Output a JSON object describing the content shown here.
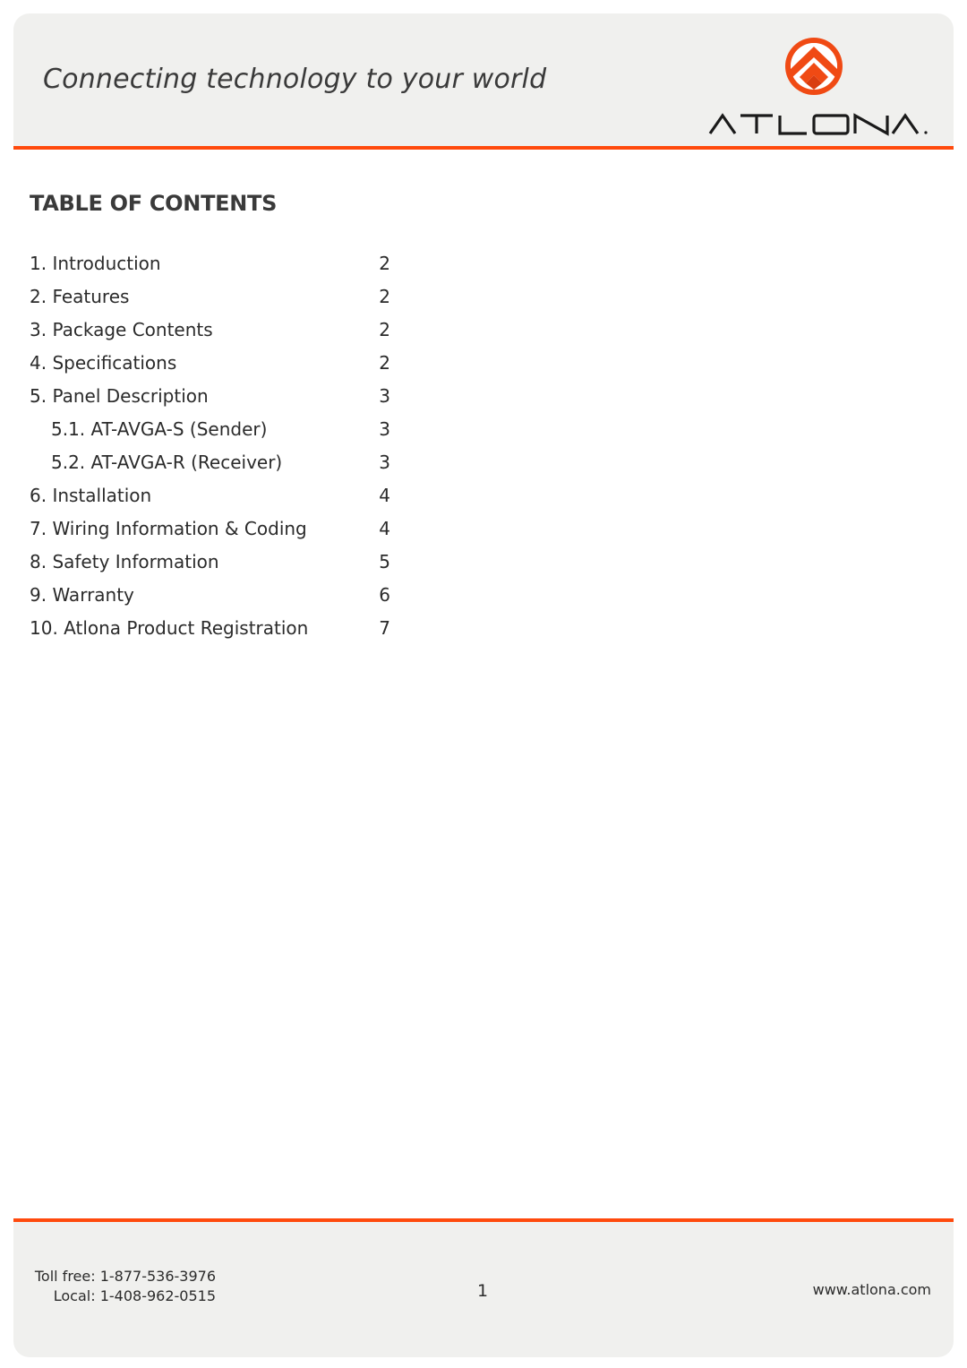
{
  "header": {
    "tagline": "Connecting technology to your world",
    "logo_text": "ATLONA",
    "accent_color": "#ff4a0d"
  },
  "toc": {
    "title": "TABLE OF CONTENTS",
    "entries": [
      {
        "label": "1. Introduction",
        "page": "2",
        "level": 1
      },
      {
        "label": "2. Features",
        "page": "2",
        "level": 1
      },
      {
        "label": "3. Package Contents",
        "page": "2",
        "level": 1
      },
      {
        "label": "4. Specifications",
        "page": "2",
        "level": 1
      },
      {
        "label": "5. Panel Description",
        "page": "3",
        "level": 1
      },
      {
        "label": "5.1. AT-AVGA-S (Sender)",
        "page": "3",
        "level": 2
      },
      {
        "label": "5.2. AT-AVGA-R (Receiver)",
        "page": "3",
        "level": 2
      },
      {
        "label": "6. Installation",
        "page": "4",
        "level": 1
      },
      {
        "label": "7. Wiring Information & Coding",
        "page": "4",
        "level": 1
      },
      {
        "label": "8. Safety Information",
        "page": "5",
        "level": 1
      },
      {
        "label": "9. Warranty",
        "page": "6",
        "level": 1
      },
      {
        "label": "10. Atlona Product Registration",
        "page": "7",
        "level": 1
      }
    ]
  },
  "footer": {
    "toll_free": "Toll free: 1-877-536-3976",
    "local": "Local: 1-408-962-0515",
    "page_number": "1",
    "website": "www.atlona.com"
  }
}
